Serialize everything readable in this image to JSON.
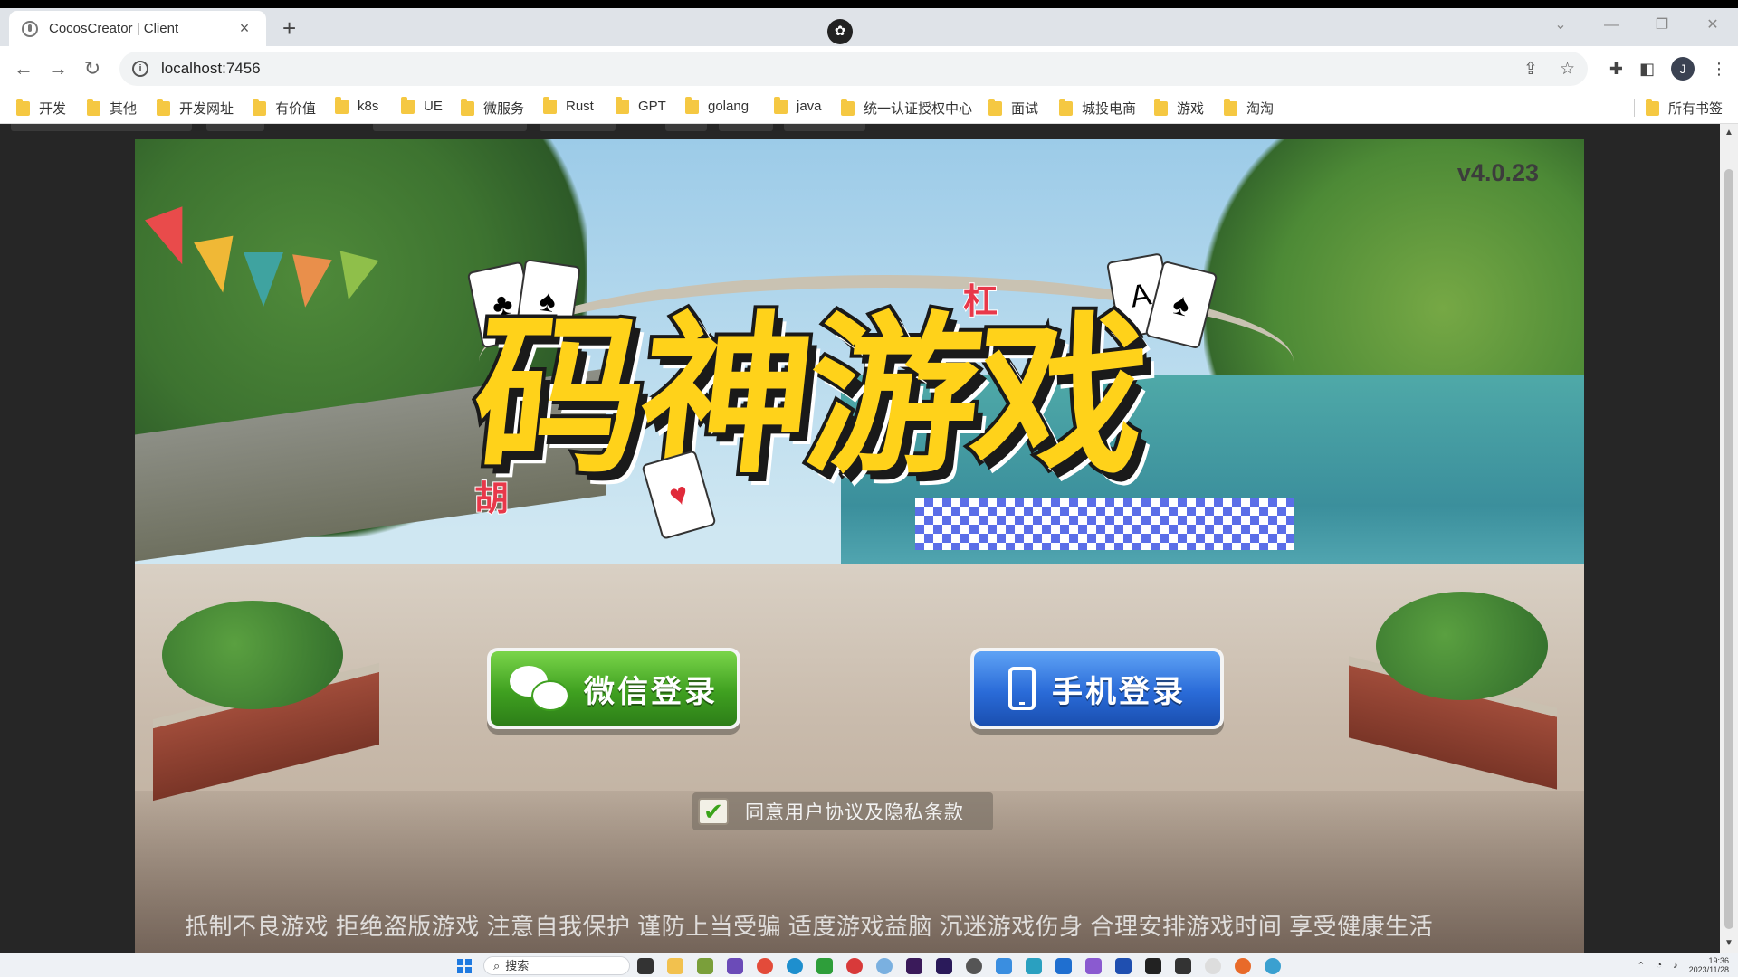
{
  "browser": {
    "tab_title": "CocosCreator | Client",
    "tab_close": "×",
    "new_tab": "+",
    "url": "localhost:7456",
    "avatar_letter": "J",
    "window_controls": [
      "⌄",
      "—",
      "❐",
      "✕"
    ]
  },
  "bookmarks": {
    "items": [
      "开发",
      "其他",
      "开发网址",
      "有价值",
      "k8s",
      "UE",
      "微服务",
      "Rust",
      "GPT",
      "golang",
      "java",
      "统一认证授权中心",
      "面试",
      "城投电商",
      "游戏",
      "淘淘"
    ],
    "all_bookmarks": "所有书签"
  },
  "game": {
    "version": "v4.0.23",
    "logo_title": "码神游戏",
    "logo_tag_top": "杠",
    "logo_tag_left": "胡",
    "wechat_login": "微信登录",
    "phone_login": "手机登录",
    "agree_check": "✔",
    "agree_text": "同意用户协议及隐私条款",
    "notice": "抵制不良游戏 拒绝盗版游戏 注意自我保护 谨防上当受骗 适度游戏益脑 沉迷游戏伤身 合理安排游戏时间 享受健康生活"
  },
  "taskbar": {
    "search_placeholder": "搜索",
    "time": "19:36",
    "date": "2023/11/28"
  },
  "colors": {
    "accent_green": "#3fa020",
    "accent_blue": "#2a6bd8",
    "logo_yellow": "#ffd21a"
  }
}
